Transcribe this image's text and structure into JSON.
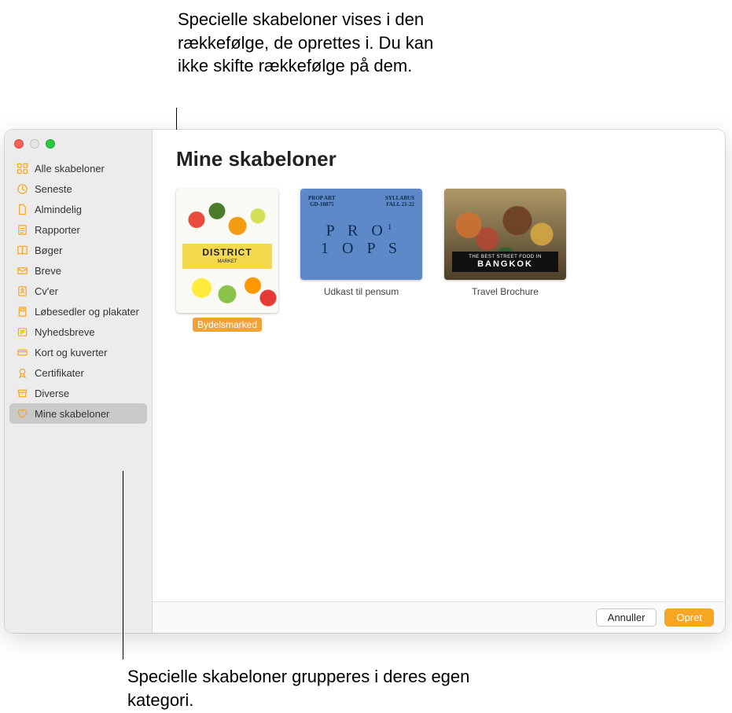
{
  "callouts": {
    "top": "Specielle skabeloner vises i den rækkefølge, de oprettes i. Du kan ikke skifte rækkefølge på dem.",
    "bottom": "Specielle skabeloner grupperes i deres egen kategori."
  },
  "sidebar": {
    "items": [
      {
        "label": "Alle skabeloner",
        "icon": "grid-icon"
      },
      {
        "label": "Seneste",
        "icon": "clock-icon"
      },
      {
        "label": "Almindelig",
        "icon": "doc-icon"
      },
      {
        "label": "Rapporter",
        "icon": "report-icon"
      },
      {
        "label": "Bøger",
        "icon": "book-icon"
      },
      {
        "label": "Breve",
        "icon": "letter-icon"
      },
      {
        "label": "Cv'er",
        "icon": "person-doc-icon"
      },
      {
        "label": "Løbesedler og plakater",
        "icon": "flyer-icon"
      },
      {
        "label": "Nyhedsbreve",
        "icon": "newsletter-icon"
      },
      {
        "label": "Kort og kuverter",
        "icon": "card-icon"
      },
      {
        "label": "Certifikater",
        "icon": "ribbon-icon"
      },
      {
        "label": "Diverse",
        "icon": "archive-icon"
      },
      {
        "label": "Mine skabeloner",
        "icon": "heart-icon",
        "selected": true
      }
    ]
  },
  "main": {
    "title": "Mine skabeloner",
    "templates": [
      {
        "label": "Bydelsmarked",
        "selected": true,
        "thumb": {
          "title": "DISTRICT",
          "subtitle": "MARKET"
        }
      },
      {
        "label": "Udkast til pensum",
        "thumb": {
          "top_left_line1": "PROP ART",
          "top_left_line2": "GD-10875",
          "top_right_line1": "SYLLABUS",
          "top_right_line2": "FALL 21-22",
          "center_line1": "P R O",
          "center_line2": "1 O P S"
        }
      },
      {
        "label": "Travel Brochure",
        "thumb": {
          "tagline": "THE BEST STREET FOOD IN",
          "city": "BANGKOK"
        }
      }
    ]
  },
  "footer": {
    "cancel": "Annuller",
    "create": "Opret"
  },
  "colors": {
    "accent": "#f6a623",
    "selection": "#f2a338"
  }
}
